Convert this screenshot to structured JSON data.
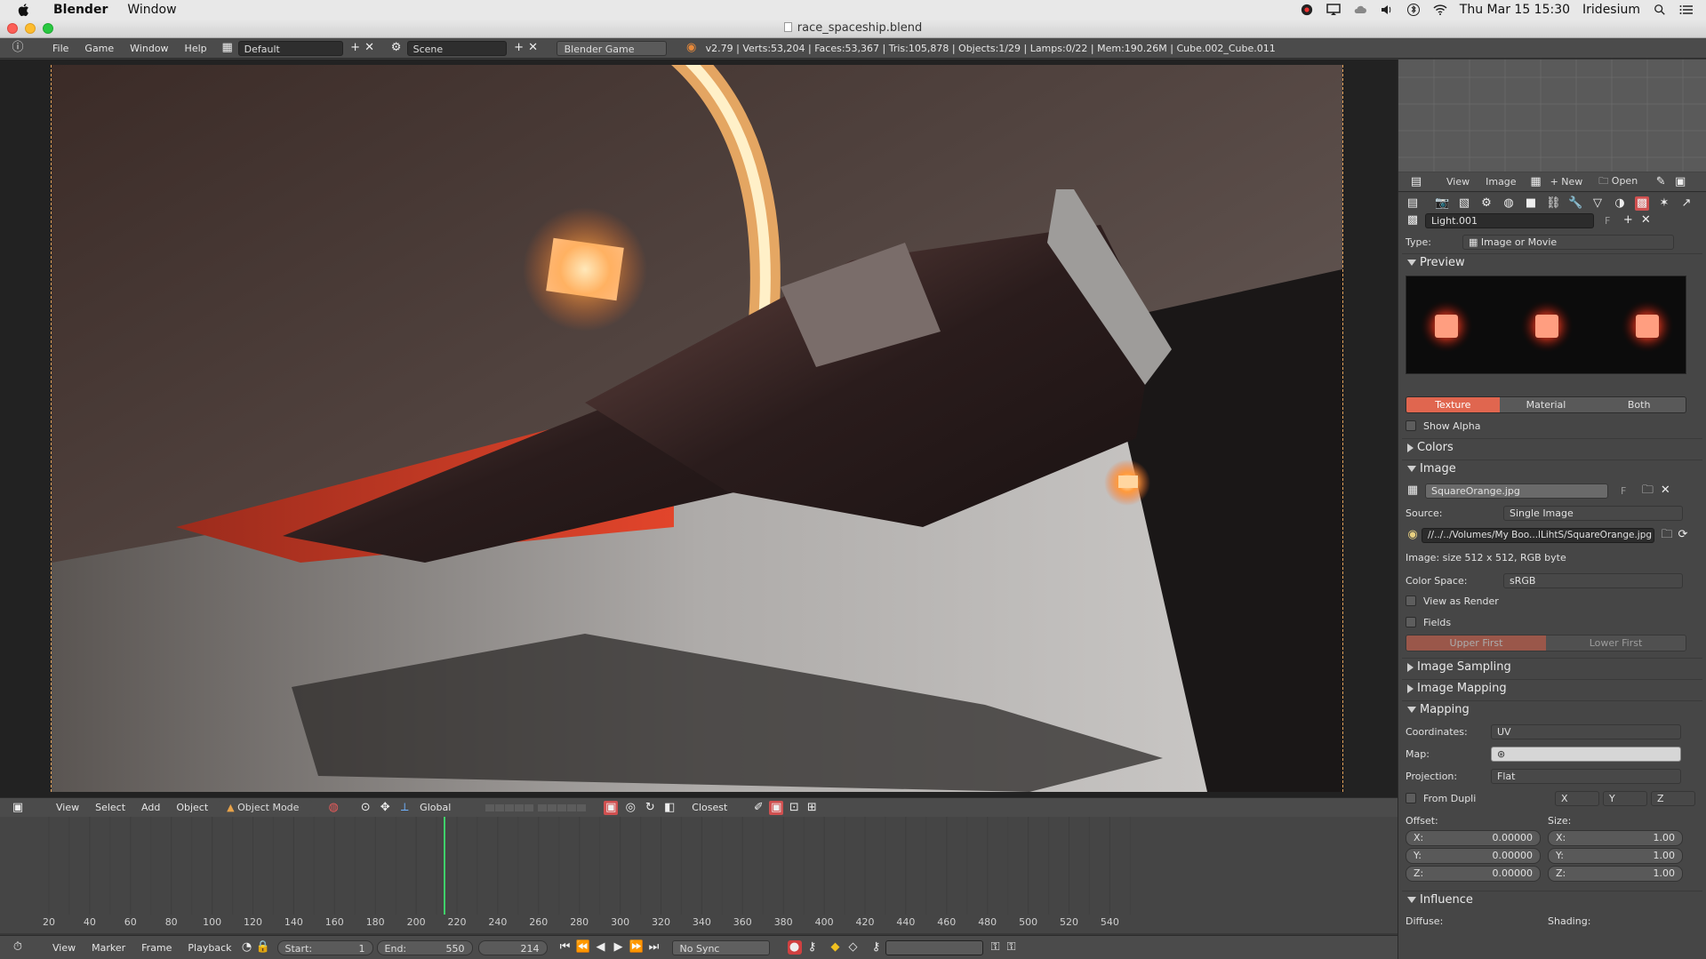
{
  "mac_menubar": {
    "app_name": "Blender",
    "menu_window": "Window",
    "datetime": "Thu Mar 15  15:30",
    "user": "Iridesium"
  },
  "window": {
    "title": "race_spaceship.blend"
  },
  "info_header": {
    "menus": [
      "File",
      "Game",
      "Window",
      "Help"
    ],
    "layout": "Default",
    "scene": "Scene",
    "engine": "Blender Game",
    "stats": "v2.79 | Verts:53,204 | Faces:53,367 | Tris:105,878 | Objects:1/29 | Lamps:0/22 | Mem:190.26M | Cube.002_Cube.011"
  },
  "viewport_header": {
    "menus": [
      "View",
      "Select",
      "Add",
      "Object"
    ],
    "mode": "Object Mode",
    "orientation": "Global",
    "snap": "Closest"
  },
  "timeline": {
    "ticks": [
      "20",
      "40",
      "60",
      "80",
      "100",
      "120",
      "140",
      "160",
      "180",
      "200",
      "220",
      "240",
      "260",
      "280",
      "300",
      "320",
      "340",
      "360",
      "380",
      "400",
      "420",
      "440",
      "460",
      "480",
      "500",
      "520",
      "540"
    ],
    "current_frame_marker": 214,
    "menus": [
      "View",
      "Marker",
      "Frame",
      "Playback"
    ],
    "start_label": "Start:",
    "start_value": "1",
    "end_label": "End:",
    "end_value": "550",
    "current_frame": "214",
    "sync": "No Sync"
  },
  "image_editor_header": {
    "menus": [
      "View",
      "Image"
    ],
    "new_label": "New",
    "open_label": "Open"
  },
  "texture_props": {
    "texture_name": "Light.001",
    "type_label": "Type:",
    "type_value": "Image or Movie",
    "preview": {
      "title": "Preview",
      "tabs": [
        "Texture",
        "Material",
        "Both"
      ],
      "active_tab": "Texture",
      "show_alpha": "Show Alpha"
    },
    "colors_title": "Colors",
    "image_panel": {
      "title": "Image",
      "image_name": "SquareOrange.jpg",
      "fake_user": "F",
      "source_label": "Source:",
      "source_value": "Single Image",
      "filepath": "//../../Volumes/My Boo...lLihtS/SquareOrange.jpg",
      "info": "Image: size 512 x 512, RGB byte",
      "color_space_label": "Color Space:",
      "color_space_value": "sRGB",
      "view_as_render": "View as Render",
      "fields": "Fields",
      "field_order": [
        "Upper First",
        "Lower First"
      ]
    },
    "image_sampling_title": "Image Sampling",
    "image_mapping_title": "Image Mapping",
    "mapping": {
      "title": "Mapping",
      "coordinates_label": "Coordinates:",
      "coordinates_value": "UV",
      "map_label": "Map:",
      "projection_label": "Projection:",
      "projection_value": "Flat",
      "from_dupli": "From Dupli",
      "axes": [
        "X",
        "Y",
        "Z"
      ],
      "offset_label": "Offset:",
      "size_label": "Size:",
      "offset": [
        {
          "axis": "X:",
          "value": "0.00000"
        },
        {
          "axis": "Y:",
          "value": "0.00000"
        },
        {
          "axis": "Z:",
          "value": "0.00000"
        }
      ],
      "size": [
        {
          "axis": "X:",
          "value": "1.00"
        },
        {
          "axis": "Y:",
          "value": "1.00"
        },
        {
          "axis": "Z:",
          "value": "1.00"
        }
      ]
    },
    "influence": {
      "title": "Influence",
      "diffuse_label": "Diffuse:",
      "shading_label": "Shading:"
    }
  },
  "colors": {
    "accent_active": "#e0664f",
    "timeline_cursor": "#3fd16a",
    "render_glow": "#ff8a3a"
  }
}
